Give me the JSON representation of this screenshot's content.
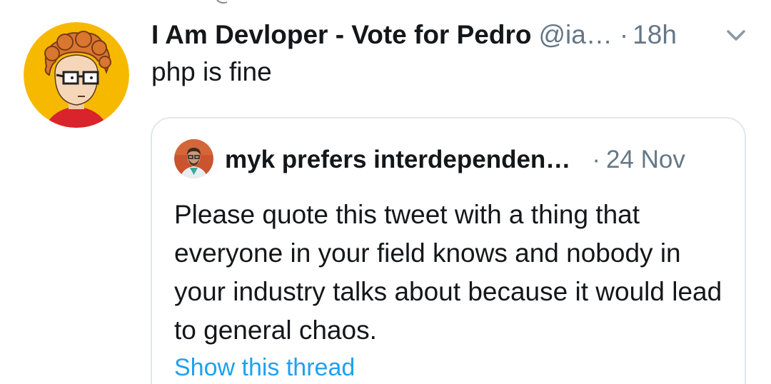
{
  "tweet": {
    "display_name": "I Am Devloper - Vote for Pedro",
    "handle": "@ia…",
    "separator": "·",
    "time": "18h",
    "text": "php is fine",
    "avatar_icon": "cartoon-developer-avatar",
    "menu_icon": "chevron-down-icon"
  },
  "quoted_tweet": {
    "display_name": "myk prefers interdependen…",
    "separator": "·",
    "time": "24 Nov",
    "text": "Please quote this tweet with a thing that everyone in your field knows and nobody in your industry talks about because it would lead to general chaos.",
    "show_thread_label": "Show this thread",
    "avatar_icon": "user-photo-avatar"
  },
  "colors": {
    "text_primary": "#14171a",
    "text_secondary": "#657786",
    "link": "#1da1f2",
    "border": "#e1e8ed",
    "avatar_bg": "#f7b900"
  }
}
